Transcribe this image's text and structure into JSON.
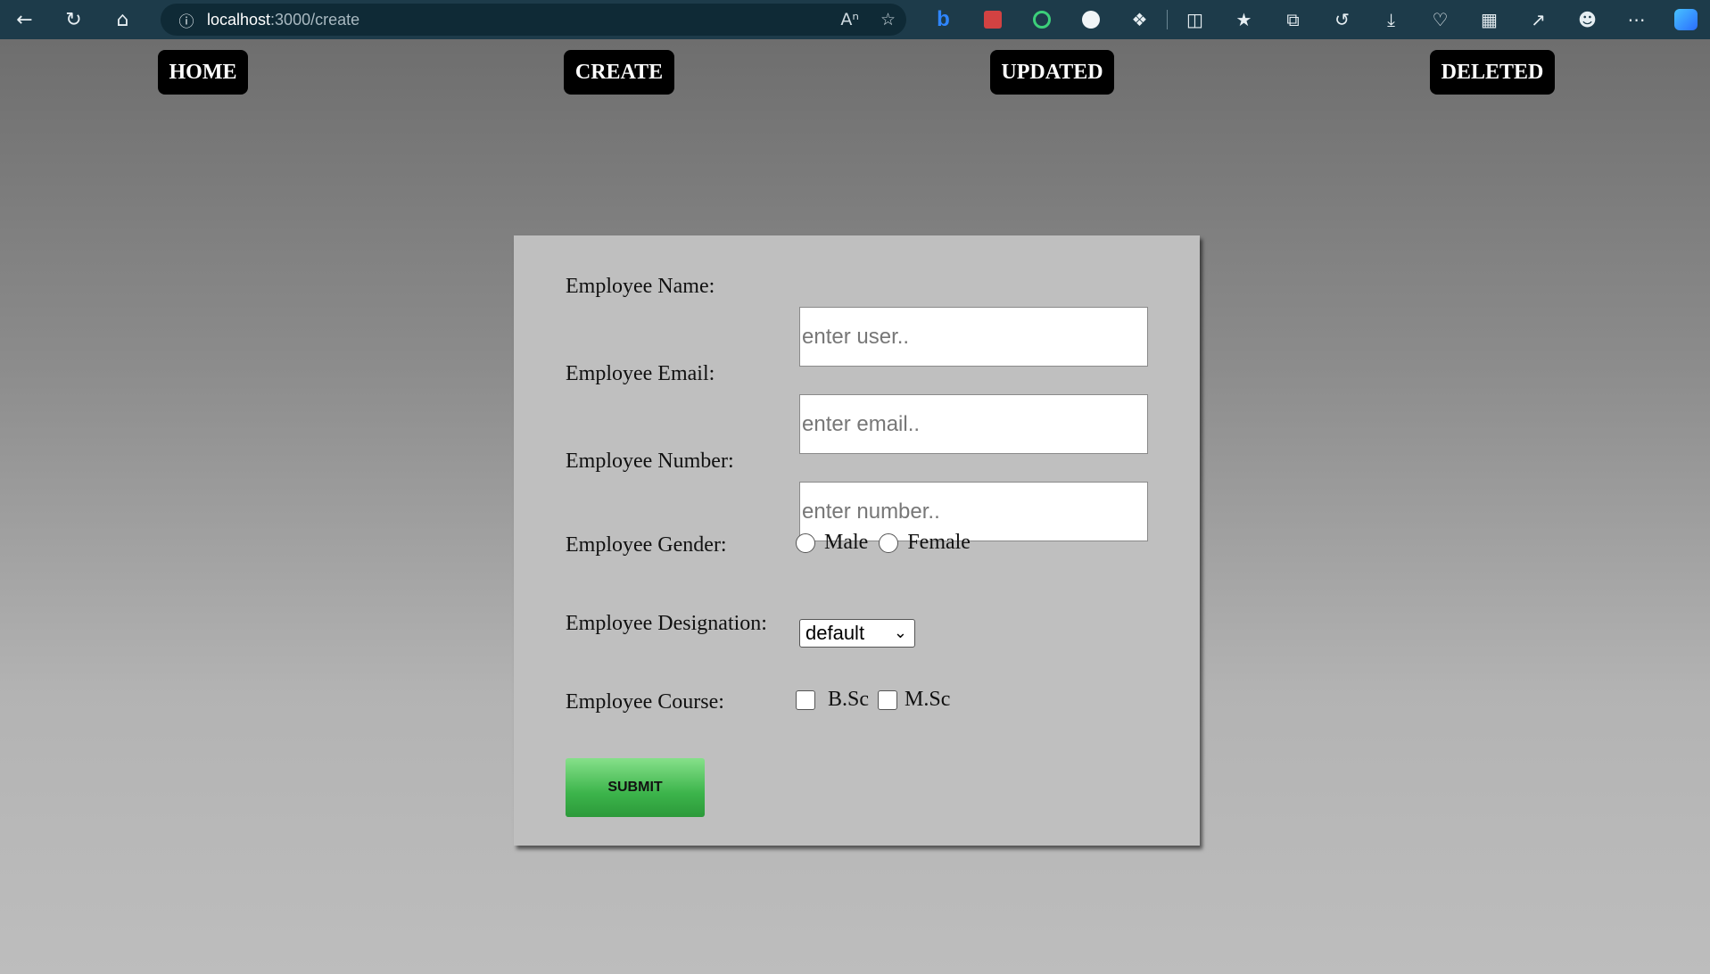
{
  "browser": {
    "url_host": "localhost",
    "url_path": ":3000/create"
  },
  "nav": {
    "home": "HOME",
    "create": "CREATE",
    "updated": "UPDATED",
    "deleted": "DELETED"
  },
  "form": {
    "name_label": "Employee Name:",
    "name_placeholder": "enter user..",
    "email_label": "Employee Email:",
    "email_placeholder": "enter email..",
    "number_label": "Employee Number:",
    "number_placeholder": "enter number..",
    "gender_label": "Employee Gender:",
    "gender_male": "Male",
    "gender_female": "Female",
    "designation_label": "Employee Designation:",
    "designation_value": "default",
    "course_label": "Employee Course:",
    "course_bsc": "B.Sc",
    "course_msc": "M.Sc",
    "submit_label": "SUBMIT"
  }
}
